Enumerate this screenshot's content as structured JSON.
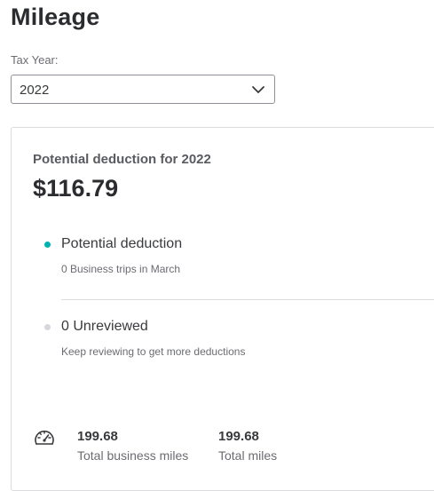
{
  "header": {
    "title": "Mileage"
  },
  "tax_year": {
    "label": "Tax Year:",
    "selected": "2022"
  },
  "summary": {
    "title": "Potential deduction for 2022",
    "amount": "$116.79",
    "items": [
      {
        "title": "Potential deduction",
        "subtitle": "0 Business trips in March",
        "dot_color": "#00b3b3"
      },
      {
        "title": "0 Unreviewed",
        "subtitle": "Keep reviewing to get more deductions",
        "dot_color": "#d4d7dc"
      }
    ],
    "stats": [
      {
        "value": "199.68",
        "label": "Total business miles"
      },
      {
        "value": "199.68",
        "label": "Total miles"
      }
    ]
  },
  "icons": {
    "select": "chevron-down-icon",
    "miles": "speedometer-icon"
  }
}
